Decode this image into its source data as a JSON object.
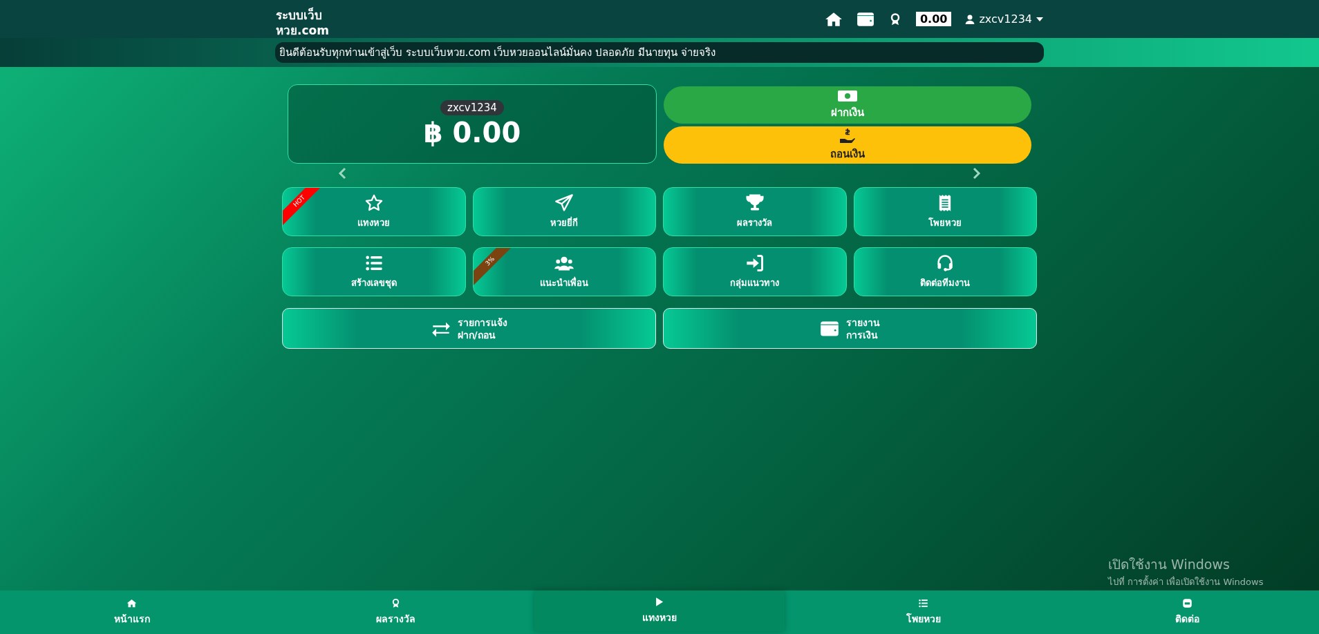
{
  "header": {
    "logo_line1": "ระบบเว็บ",
    "logo_line2": "หวย.com",
    "balance": "0.00",
    "username": "zxcv1234"
  },
  "ticker": "ยินดีต้อนรับทุกท่านเข้าสู่เว็บ ระบบเว็บหวย.com เว็บหวยออนไลน์มั่นคง ปลอดภัย มีนายทุน จ่ายจริง",
  "account": {
    "username": "zxcv1234",
    "balance": "฿ 0.00"
  },
  "actions": [
    {
      "label": "ฝากเงิน",
      "kind": "deposit"
    },
    {
      "label": "ถอนเงิน",
      "kind": "withdraw"
    }
  ],
  "menu": [
    {
      "label": "แทงหวย",
      "ribbon": "HOT",
      "color": "#ff0000"
    },
    {
      "label": "หวยยี่กี"
    },
    {
      "label": "ผลรางวัล"
    },
    {
      "label": "โพยหวย"
    },
    {
      "label": "สร้างเลขชุด"
    },
    {
      "label": "แนะนำเพื่อน",
      "ribbon": "3%",
      "color": "#7a4310"
    },
    {
      "label": "กลุ่มแนวทาง"
    },
    {
      "label": "ติดต่อทีมงาน"
    }
  ],
  "wide_menu": [
    {
      "lines": [
        "รายการแจ้ง",
        "ฝาก/ถอน"
      ]
    },
    {
      "lines": [
        "รายงาน",
        "การเงิน"
      ]
    }
  ],
  "bottom_nav": [
    {
      "label": "หน้าแรก",
      "selected": false
    },
    {
      "label": "ผลรางวัล",
      "selected": false
    },
    {
      "label": "แทงหวย",
      "selected": true
    },
    {
      "label": "โพยหวย",
      "selected": false
    },
    {
      "label": "ติดต่อ",
      "selected": false
    }
  ],
  "os_notice": {
    "title": "เปิดใช้งาน Windows",
    "subtitle": "ไปที่ การตั้งค่า เพื่อเปิดใช้งาน Windows"
  }
}
